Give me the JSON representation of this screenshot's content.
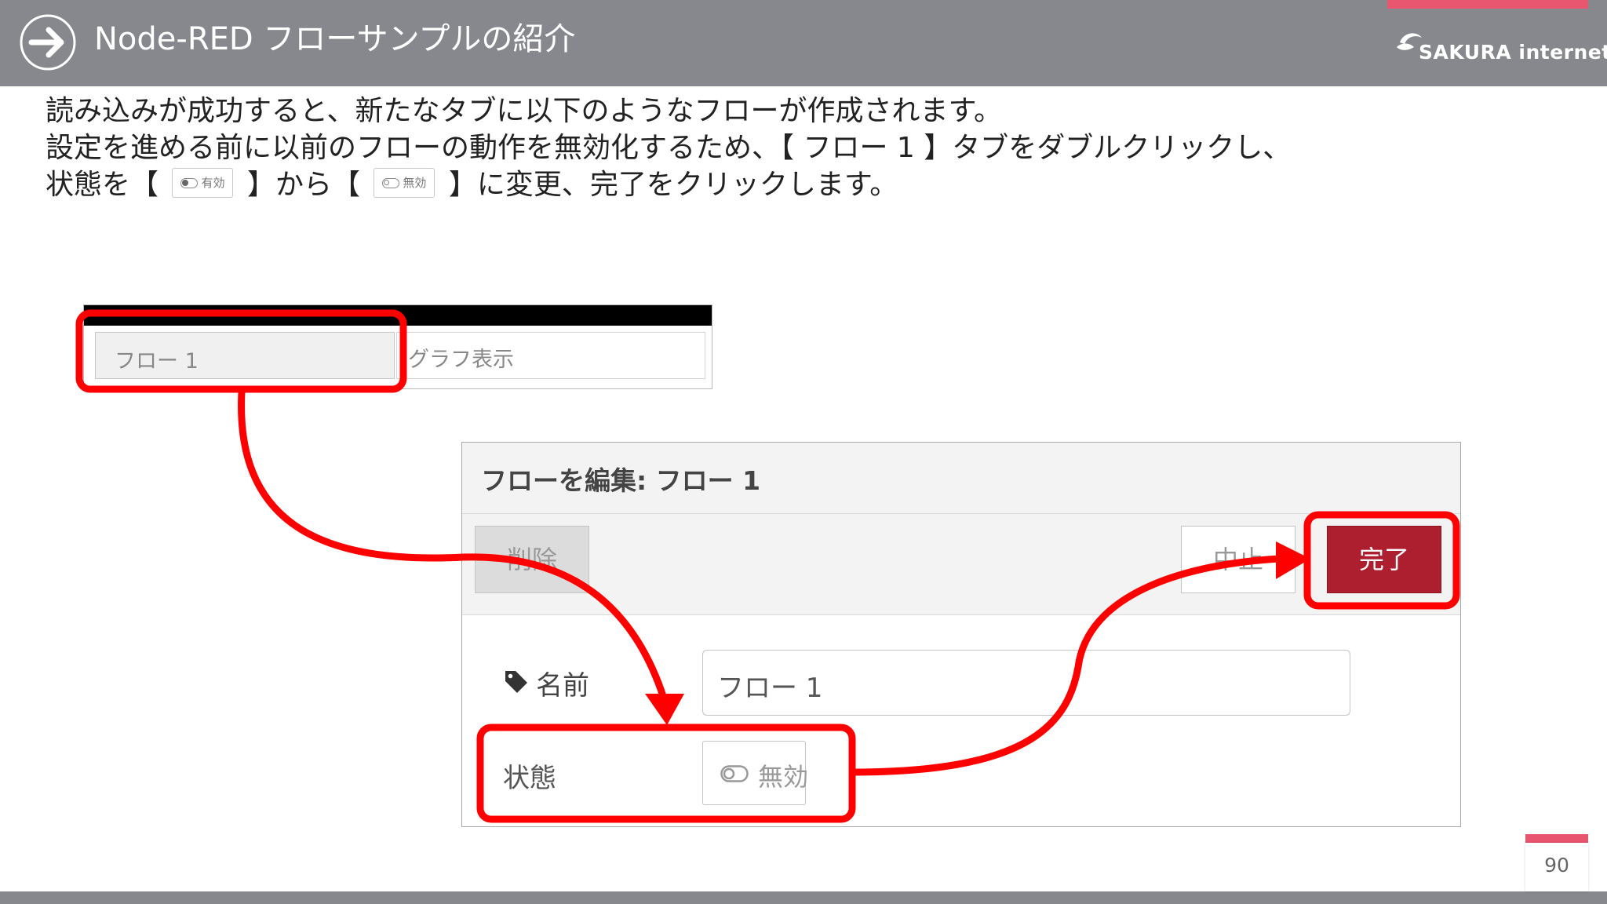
{
  "header": {
    "title": "Node-RED フローサンプルの紹介",
    "logo_text": "SAKURA internet",
    "background_color": "#86888d",
    "accent_color": "#e8566f"
  },
  "body": {
    "line1": "読み込みが成功すると、新たなタブに以下のようなフローが作成されます。",
    "line2": "設定を進める前に以前のフローの動作を無効化するため、【 フロー 1 】タブをダブルクリックし、",
    "line3_before": "状態を【",
    "line3_middle": "】から【",
    "line3_after": "】に変更、完了をクリックします。",
    "toggle_enabled_label": "有効",
    "toggle_disabled_label": "無効"
  },
  "tabs": {
    "tab1_label": "フロー 1",
    "tab2_label": "グラフ表示"
  },
  "dialog": {
    "title": "フローを編集: フロー 1",
    "delete_label": "削除",
    "cancel_label": "中止",
    "done_label": "完了",
    "done_color": "#ad1f2f",
    "name_label": "名前",
    "name_value": "フロー 1",
    "state_label": "状態",
    "state_value": "無効"
  },
  "annotation": {
    "highlight_color": "#ff0000"
  },
  "footer": {
    "page_number": "90"
  }
}
